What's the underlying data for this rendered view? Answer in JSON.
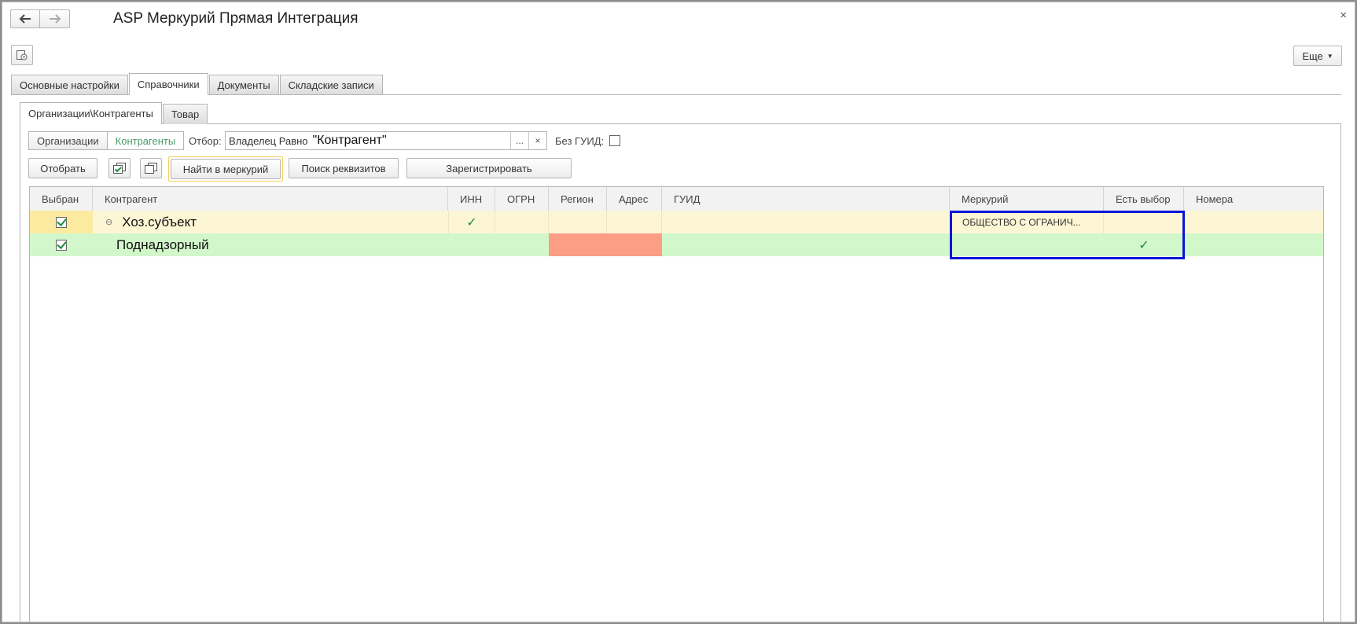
{
  "window": {
    "title": "ASP Меркурий Прямая Интеграция",
    "close_glyph": "×",
    "back_glyph": "🡐",
    "forward_glyph": "🡒"
  },
  "toolbar": {
    "more_label": "Еще"
  },
  "main_tabs": [
    {
      "label": "Основные настройки",
      "active": false
    },
    {
      "label": "Справочники",
      "active": true
    },
    {
      "label": "Документы",
      "active": false
    },
    {
      "label": "Складские записи",
      "active": false
    }
  ],
  "sub_tabs": [
    {
      "label": "Организации\\Контрагенты",
      "active": true
    },
    {
      "label": "Товар",
      "active": false
    }
  ],
  "segment": {
    "organizations": "Организации",
    "counterparties": "Контрагенты"
  },
  "filter": {
    "label": "Отбор:",
    "prefix": "Владелец Равно",
    "value": "\"Контрагент\"",
    "dots": "...",
    "clear": "×"
  },
  "no_guid": {
    "label": "Без ГУИД:",
    "checked": false
  },
  "actions": {
    "select": "Отобрать",
    "find_mercury": "Найти в меркурий",
    "search_requisites": "Поиск реквизитов",
    "register": "Зарегистрировать"
  },
  "table": {
    "columns": [
      "Выбран",
      "Контрагент",
      "ИНН",
      "ОГРН",
      "Регион",
      "Адрес",
      "ГУИД",
      "Меркурий",
      "Есть выбор",
      "Номера"
    ],
    "rows": [
      {
        "selected": true,
        "name": "Хоз.субъект",
        "inn": "✓",
        "mercury": "ОБЩЕСТВО С ОГРАНИЧ...",
        "has_choice": ""
      },
      {
        "selected": true,
        "name": "Поднадзорный",
        "inn": "",
        "mercury": "",
        "has_choice": "✓"
      }
    ]
  },
  "colors": {
    "group_row": "#fdf6d5",
    "child_row": "#d2f7ca",
    "error_cell": "#fb9e85",
    "selection_frame": "#0a16d8",
    "check": "#1e8a3c"
  }
}
